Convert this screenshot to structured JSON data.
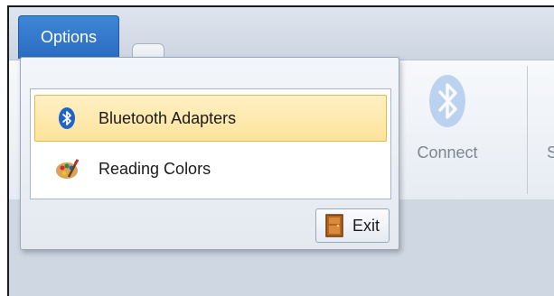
{
  "app_tab": {
    "label": "Options"
  },
  "ribbon": {
    "connect_label": "Connect",
    "partial_label": "S"
  },
  "menu": {
    "items": [
      {
        "label": "Bluetooth Adapters",
        "icon": "bluetooth-icon",
        "selected": true
      },
      {
        "label": "Reading Colors",
        "icon": "palette-icon",
        "selected": false
      }
    ],
    "exit_label": "Exit",
    "exit_icon": "door-icon"
  },
  "colors": {
    "tab_blue": "#2a6cc0",
    "highlight": "#fde39a",
    "bluetooth": "#1f63c9"
  }
}
